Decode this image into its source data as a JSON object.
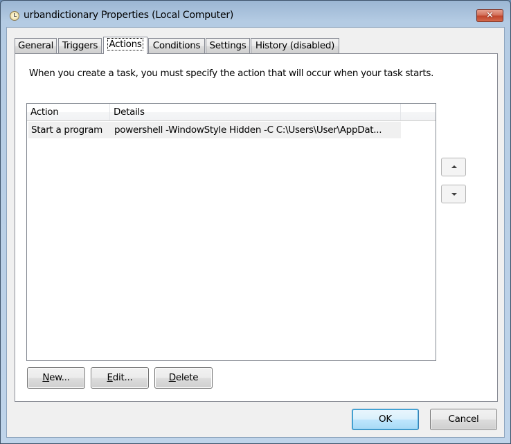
{
  "window": {
    "title": "urbandictionary Properties (Local Computer)",
    "icon": "task-scheduler-clock-icon",
    "close_label": "✕"
  },
  "tabs": [
    {
      "label": "General",
      "active": false
    },
    {
      "label": "Triggers",
      "active": false
    },
    {
      "label": "Actions",
      "active": true
    },
    {
      "label": "Conditions",
      "active": false
    },
    {
      "label": "Settings",
      "active": false
    },
    {
      "label": "History (disabled)",
      "active": false
    }
  ],
  "actions_tab": {
    "description": "When you create a task, you must specify the action that will occur when your task starts.",
    "list": {
      "columns": [
        "Action",
        "Details"
      ],
      "rows": [
        {
          "action": "Start a program",
          "details": "powershell -WindowStyle Hidden  -C C:\\Users\\User\\AppDat..."
        }
      ]
    },
    "move_up_icon": "triangle-up-icon",
    "move_down_icon": "triangle-down-icon",
    "buttons": {
      "new": {
        "mnemonic": "N",
        "rest": "ew..."
      },
      "edit": {
        "mnemonic": "E",
        "rest": "dit..."
      },
      "delete": {
        "mnemonic": "D",
        "rest": "elete"
      }
    }
  },
  "footer": {
    "ok_label": "OK",
    "cancel_label": "Cancel"
  }
}
